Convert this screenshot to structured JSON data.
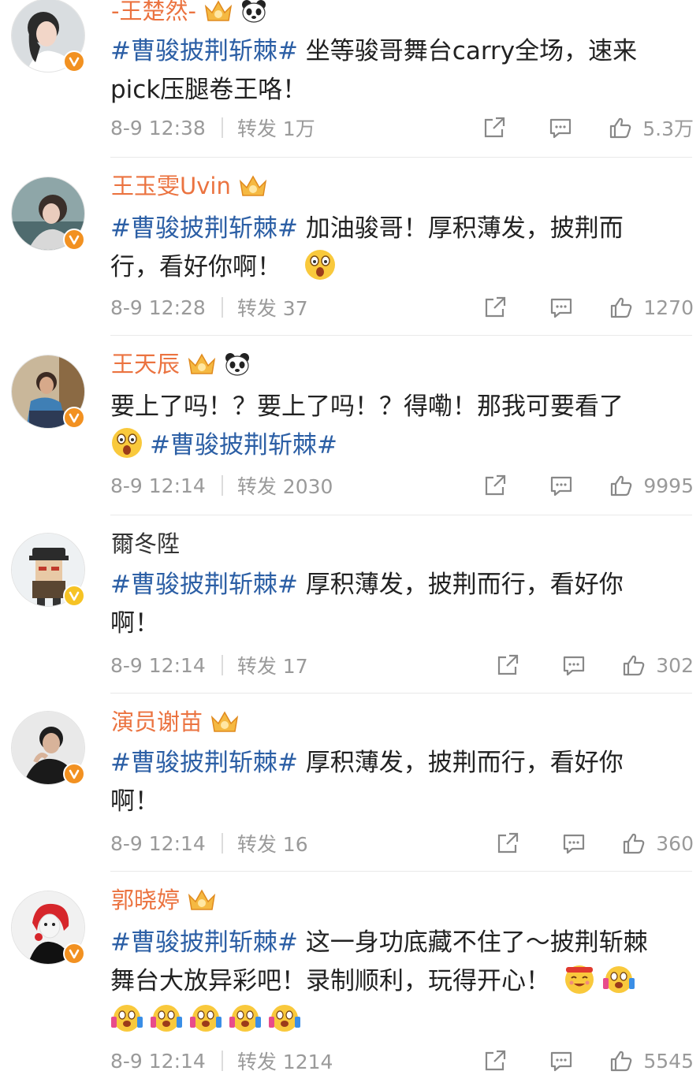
{
  "comments": [
    {
      "name": "-王楚然-",
      "name_style": "orange",
      "badges": [
        "crown-icon",
        "panda-icon"
      ],
      "verified": "orange",
      "hashtag": "#曹骏披荆斩棘#",
      "text_line1": " 坐等骏哥舞台carry全场，速来",
      "text_line2": "pick压腿卷王咯！",
      "time": "8-9 12:38",
      "repost_label": "转发",
      "repost_count": "1万",
      "likes": "5.3万"
    },
    {
      "name": "王玉雯Uvin",
      "name_style": "orange",
      "badges": [
        "crown-icon"
      ],
      "verified": "orange",
      "hashtag": "#曹骏披荆斩棘#",
      "text_line1": " 加油骏哥！厚积薄发，披荆而",
      "text_line2": "行，看好你啊！",
      "emoji_line2": [
        "scream-emoji"
      ],
      "time": "8-9 12:28",
      "repost_label": "转发",
      "repost_count": "37",
      "likes": "1270"
    },
    {
      "name": "王天辰",
      "name_style": "orange",
      "badges": [
        "crown-icon",
        "panda-icon"
      ],
      "verified": "orange",
      "text_line1": "要上了吗！？要上了吗！？得嘞！那我可要看了",
      "emoji_line2_lead": [
        "scream-emoji"
      ],
      "hashtag_line2": "#曹骏披荆斩棘#",
      "time": "8-9 12:14",
      "repost_label": "转发",
      "repost_count": "2030",
      "likes": "9995"
    },
    {
      "name": "爾冬陞",
      "name_style": "plain",
      "badges": [],
      "verified": "yellow",
      "hashtag": "#曹骏披荆斩棘#",
      "text_line1": " 厚积薄发，披荆而行，看好你",
      "text_line2": "啊！",
      "time": "8-9 12:14",
      "repost_label": "转发",
      "repost_count": "17",
      "likes": "302"
    },
    {
      "name": "演员谢苗",
      "name_style": "orange",
      "badges": [
        "crown-icon"
      ],
      "verified": "orange",
      "hashtag": "#曹骏披荆斩棘#",
      "text_line1": " 厚积薄发，披荆而行，看好你",
      "text_line2": "啊！",
      "time": "8-9 12:14",
      "repost_label": "转发",
      "repost_count": "16",
      "likes": "360"
    },
    {
      "name": "郭晓婷",
      "name_style": "orange",
      "badges": [
        "crown-icon"
      ],
      "verified": "orange",
      "hashtag": "#曹骏披荆斩棘#",
      "text_line1": " 这一身功底藏不住了～披荆斩棘",
      "text_line2": "舞台大放异彩吧！录制顺利，玩得开心！",
      "emoji_line2": [
        "cheer-emoji",
        "cheer-emoji"
      ],
      "emoji_line3": [
        "cheer-emoji",
        "cheer-emoji",
        "cheer-emoji",
        "cheer-emoji",
        "cheer-emoji"
      ],
      "time": "8-9 12:14",
      "repost_label": "转发",
      "repost_count": "1214",
      "likes": "5545"
    }
  ],
  "icons": {
    "share": "share-icon",
    "reply": "comment-icon",
    "like": "thumbs-up-icon",
    "verified": "verified-v-icon"
  },
  "colors": {
    "name_orange": "#eb7340",
    "hashtag_blue": "#2c5fa5",
    "meta_gray": "#9a9a9a",
    "verified_orange": "#f29121",
    "verified_yellow": "#f6c324"
  }
}
